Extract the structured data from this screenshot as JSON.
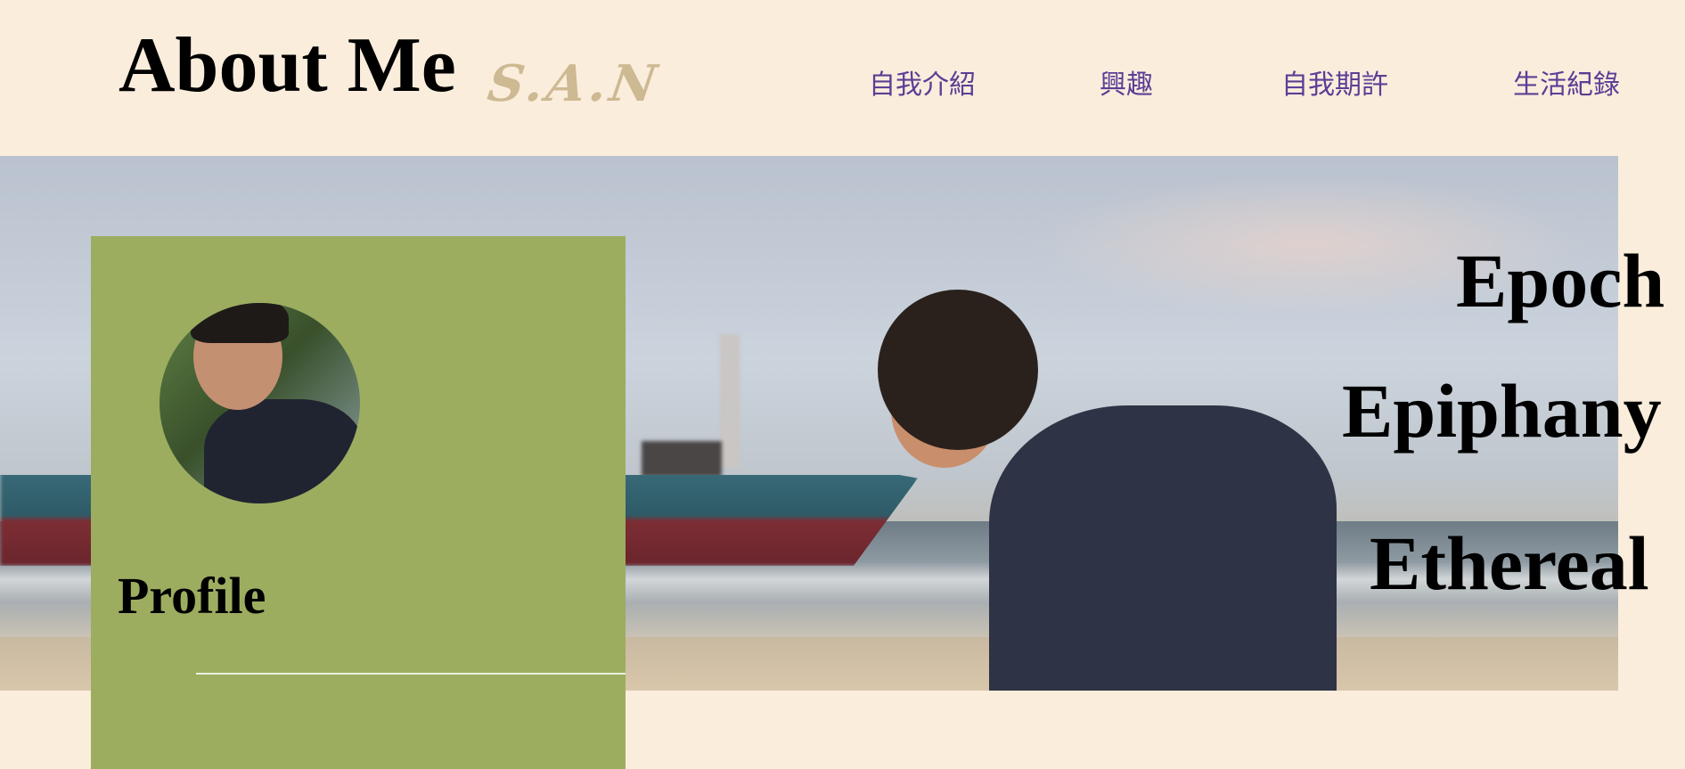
{
  "header": {
    "title": "About Me",
    "subtitle": "S.A.N",
    "nav": [
      {
        "label": "自我介紹"
      },
      {
        "label": "興趣"
      },
      {
        "label": "自我期許"
      },
      {
        "label": "生活紀錄"
      }
    ]
  },
  "hero": {
    "words": [
      "Epoch",
      "Epiphany",
      "Ethereal"
    ]
  },
  "profile": {
    "heading": "Profile"
  },
  "colors": {
    "background": "#FAEDDC",
    "card": "#9CAD60",
    "nav_text": "#5B3F95",
    "subtitle": "#CDB992"
  }
}
